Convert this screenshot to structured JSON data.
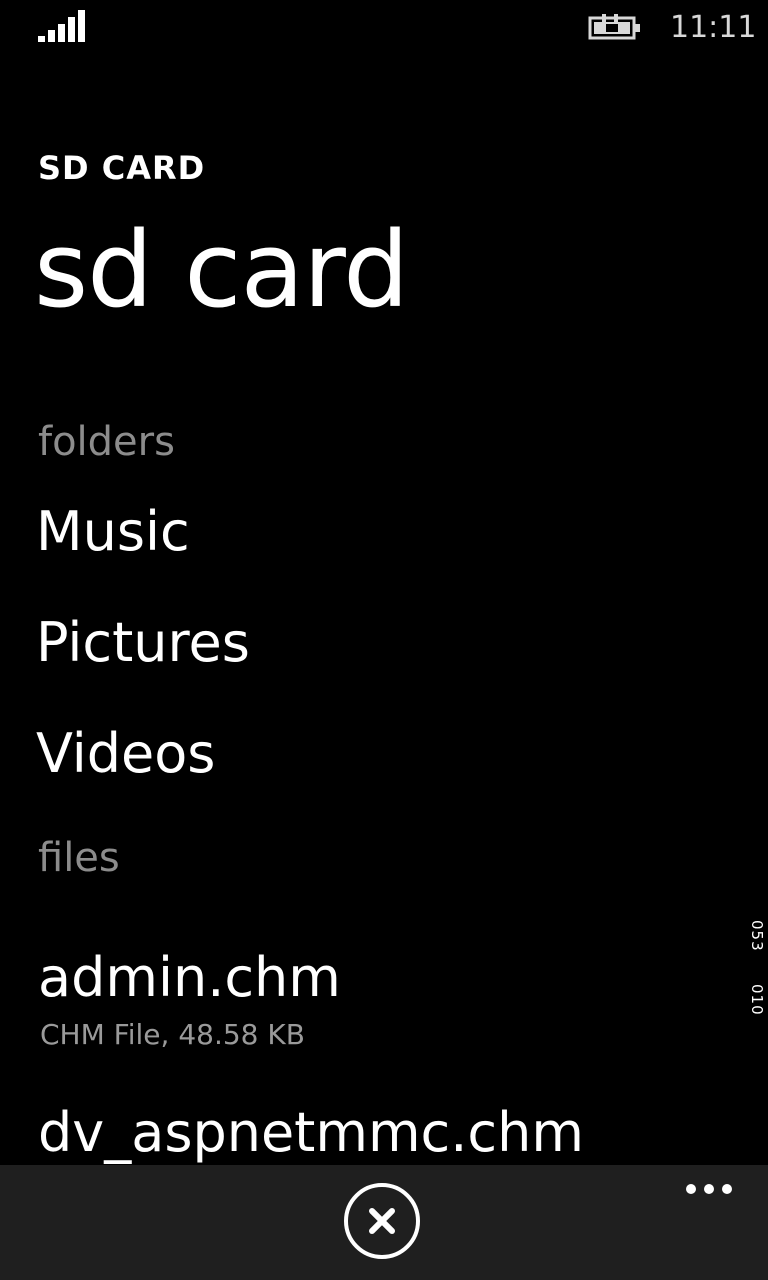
{
  "status_bar": {
    "time": "11:11",
    "signal_icon": "signal-bars-icon",
    "battery_icon": "battery-charging-icon"
  },
  "header": {
    "app_title": "SD CARD",
    "page_title": "sd card"
  },
  "folders": {
    "label": "folders",
    "items": [
      "Music",
      "Pictures",
      "Videos"
    ]
  },
  "files": {
    "label": "files",
    "items": [
      {
        "name": "admin.chm",
        "meta": "CHM File, 48.58 KB"
      },
      {
        "name": "dv_aspnetmmc.chm",
        "meta": ""
      }
    ]
  },
  "side_text": {
    "top": "053",
    "bottom": "010"
  },
  "app_bar": {
    "cancel_icon": "close-icon",
    "more_icon": "ellipsis-icon"
  }
}
